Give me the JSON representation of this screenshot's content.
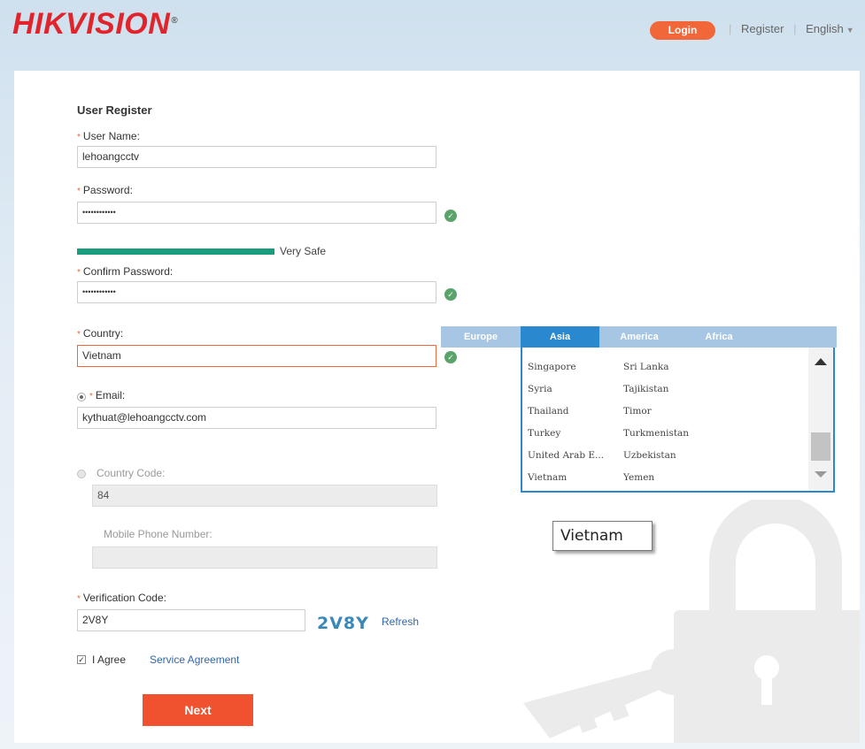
{
  "header": {
    "logo_text": "HIKVISION",
    "logo_mark": "®",
    "login_label": "Login",
    "register_label": "Register",
    "language_label": "English",
    "separator": "|"
  },
  "form": {
    "title": "User Register",
    "required_mark": "*",
    "username": {
      "label": "User Name:",
      "value": "lehoangcctv"
    },
    "password": {
      "label": "Password:",
      "value": "••••••••••••",
      "status_icon": "check-icon"
    },
    "strength": {
      "label": "Very Safe",
      "level": 1.0,
      "color": "#1a9c7e"
    },
    "confirm_password": {
      "label": "Confirm Password:",
      "value": "••••••••••••",
      "status_icon": "check-icon"
    },
    "country": {
      "label": "Country:",
      "value": "Vietnam",
      "status_icon": "check-icon"
    },
    "email": {
      "label": "Email:",
      "value": "kythuat@lehoangcctv.com",
      "selected": true
    },
    "phone": {
      "country_code_label": "Country Code:",
      "country_code_value": "84",
      "mobile_label": "Mobile Phone Number:",
      "mobile_value": "",
      "selected": false
    },
    "verification": {
      "label": "Verification Code:",
      "value": "2V8Y",
      "captcha": "2V8Y",
      "refresh_label": "Refresh"
    },
    "agreement": {
      "checked": true,
      "agree_label": "I Agree",
      "link_label": "Service Agreement"
    },
    "next_label": "Next"
  },
  "country_dropdown": {
    "tabs": [
      {
        "label": "Europe",
        "active": false
      },
      {
        "label": "Asia",
        "active": true
      },
      {
        "label": "America",
        "active": false
      },
      {
        "label": "Africa",
        "active": false
      }
    ],
    "rows": [
      [
        "Singapore",
        "Sri Lanka"
      ],
      [
        "Syria",
        "Tajikistan"
      ],
      [
        "Thailand",
        "Timor"
      ],
      [
        "Turkey",
        "Turkmenistan"
      ],
      [
        "United Arab E...",
        "Uzbekistan"
      ],
      [
        "Vietnam",
        "Yemen"
      ]
    ],
    "tooltip": "Vietnam"
  },
  "colors": {
    "brand_red": "#e1242b",
    "accent_orange": "#f2673a",
    "tab_active": "#2a88cf",
    "success_green": "#5aa46b"
  }
}
